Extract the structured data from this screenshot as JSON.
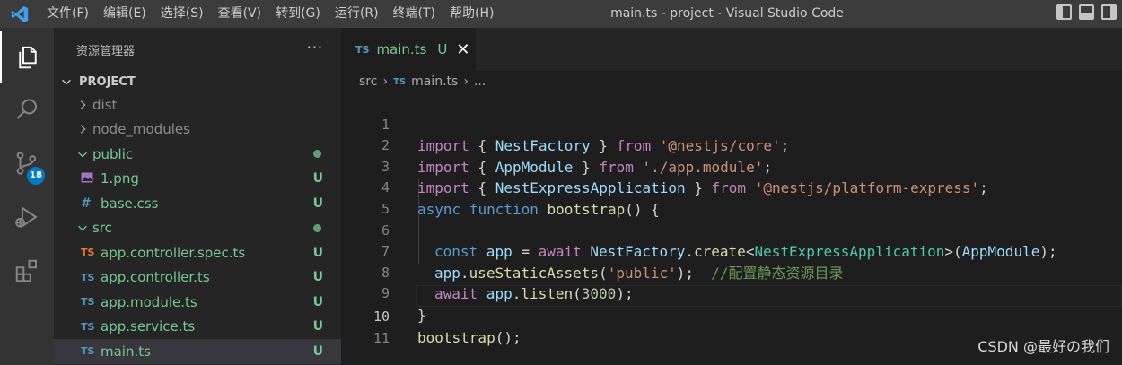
{
  "titlebar": {
    "menu": [
      "文件(F)",
      "编辑(E)",
      "选择(S)",
      "查看(V)",
      "转到(G)",
      "运行(R)",
      "终端(T)",
      "帮助(H)"
    ],
    "title": "main.ts - project - Visual Studio Code"
  },
  "activity": {
    "scm_badge": "18"
  },
  "sidebar": {
    "header": "资源管理器",
    "more": "···",
    "project": "PROJECT",
    "tree": [
      {
        "label": "dist",
        "icon": "chevron-right",
        "status": ""
      },
      {
        "label": "node_modules",
        "icon": "chevron-right",
        "status": ""
      },
      {
        "label": "public",
        "icon": "chevron-down",
        "status": "dot"
      },
      {
        "label": "1.png",
        "icon": "image",
        "status": "U"
      },
      {
        "label": "base.css",
        "icon": "#",
        "status": "U"
      },
      {
        "label": "src",
        "icon": "chevron-down",
        "status": "dot"
      },
      {
        "label": "app.controller.spec.ts",
        "icon": "TS",
        "status": "U"
      },
      {
        "label": "app.controller.ts",
        "icon": "TS",
        "status": "U"
      },
      {
        "label": "app.module.ts",
        "icon": "TS",
        "status": "U"
      },
      {
        "label": "app.service.ts",
        "icon": "TS",
        "status": "U"
      },
      {
        "label": "main.ts",
        "icon": "TS",
        "status": "U"
      }
    ]
  },
  "tab": {
    "icon": "TS",
    "label": "main.ts",
    "status": "U",
    "close": "✕"
  },
  "breadcrumbs": {
    "folder": "src",
    "icon": "TS",
    "file": "main.ts",
    "rest": "..."
  },
  "editor": {
    "line_numbers": [
      "1",
      "2",
      "3",
      "4",
      "5",
      "6",
      "7",
      "8",
      "9",
      "10",
      "11"
    ],
    "lines": {
      "l1_import": "import",
      "l1_a": " { ",
      "l1_b": "NestFactory",
      "l1_c": " } ",
      "l1_from": "from",
      "l1_s": " '@nestjs/core'",
      "l1_end": ";",
      "l2_import": "import",
      "l2_a": " { ",
      "l2_b": "AppModule",
      "l2_c": " } ",
      "l2_from": "from",
      "l2_s": " './app.module'",
      "l2_end": ";",
      "l3_import": "import",
      "l3_a": " { ",
      "l3_b": "NestExpressApplication",
      "l3_c": " } ",
      "l3_from": "from",
      "l3_s": " '@nestjs/platform-express'",
      "l3_end": ";",
      "l4_async": "async",
      "l4_function": " function",
      "l4_name": " bootstrap",
      "l4_end": "() {",
      "l6_const": "const",
      "l6_app": " app",
      "l6_eq": " = ",
      "l6_await": "await",
      "l6_nf": " NestFactory",
      "l6_dot": ".",
      "l6_create": "create",
      "l6_lt": "<",
      "l6_type": "NestExpressApplication",
      "l6_gt": ">(",
      "l6_am": "AppModule",
      "l6_end": ");",
      "l7_app": "app",
      "l7_dot": ".",
      "l7_fn": "useStaticAssets",
      "l7_p": "(",
      "l7_s": "'public'",
      "l7_end": ");  ",
      "l7_comment": "//配置静态资源目录",
      "l8_await": "await",
      "l8_app": " app",
      "l8_dot": ".",
      "l8_fn": "listen",
      "l8_p": "(",
      "l8_num": "3000",
      "l8_end": ");",
      "l9": "}",
      "l10_fn": "bootstrap",
      "l10_end": "();"
    }
  },
  "watermark": "CSDN @最好の我们",
  "colors": {
    "accent": "#007acc",
    "git_untracked": "#73c991"
  }
}
